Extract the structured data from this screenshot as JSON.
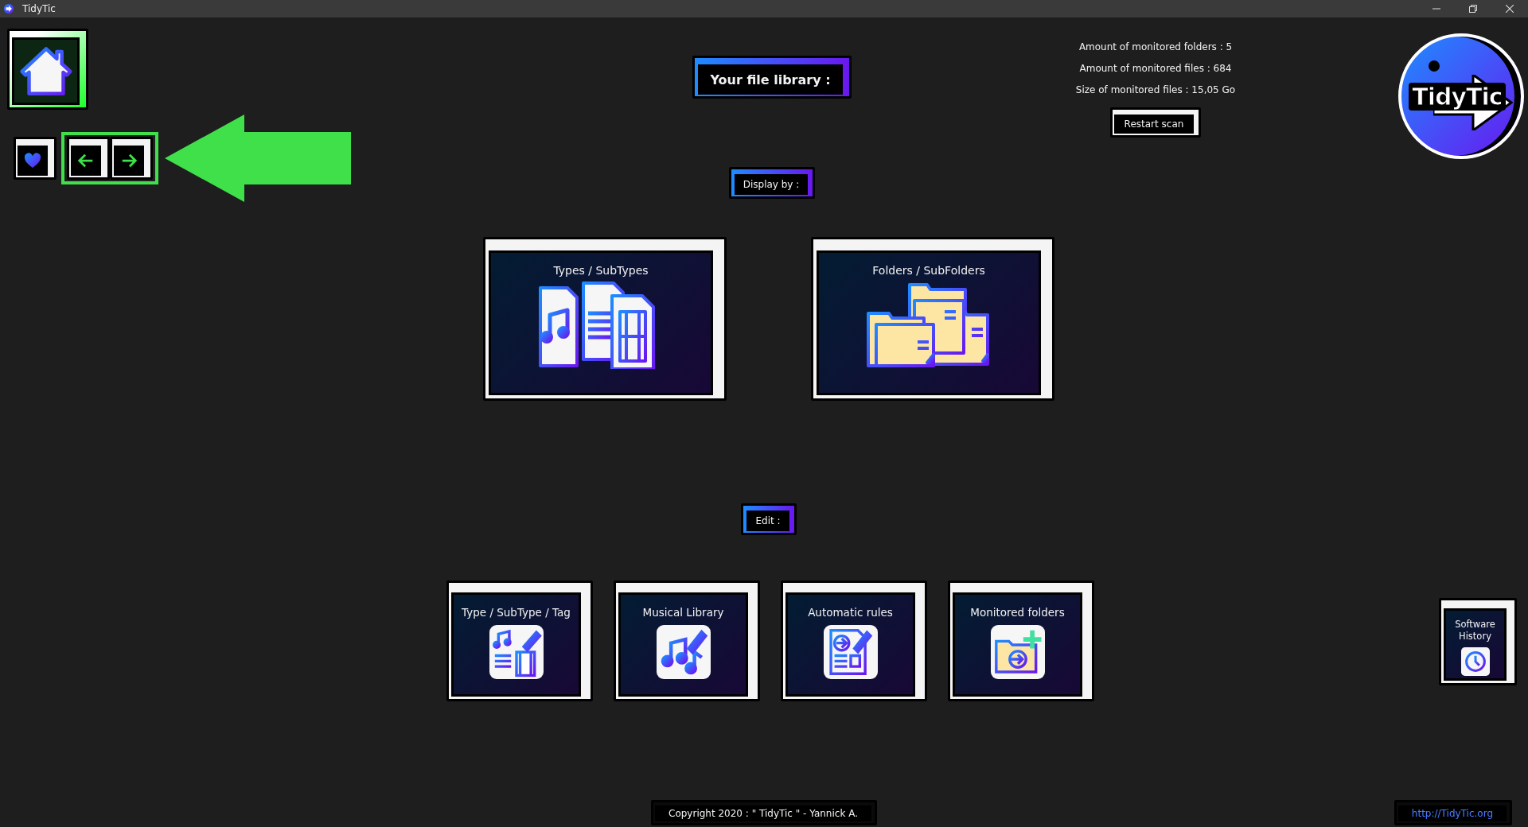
{
  "window": {
    "title": "TidyTic"
  },
  "home": {
    "selected": true
  },
  "library_label": "Your file library :",
  "stats": [
    "Amount of monitored folders : 5",
    "Amount of monitored files : 684",
    "Size of monitored files : 15,05 Go"
  ],
  "restart_button": "Restart scan",
  "logo_text": "TidyTic",
  "display_label": "Display by :",
  "display_options": [
    {
      "label": "Types / SubTypes",
      "kind": "types"
    },
    {
      "label": "Folders / SubFolders",
      "kind": "folders"
    }
  ],
  "edit_label": "Edit :",
  "edit_options": [
    {
      "label": "Type / SubType / Tag",
      "kind": "tags"
    },
    {
      "label": "Musical Library",
      "kind": "music"
    },
    {
      "label": "Automatic rules",
      "kind": "rules"
    },
    {
      "label": "Monitored folders",
      "kind": "folders"
    }
  ],
  "history_button": "Software History",
  "copyright": "Copyright 2020 : \" TidyTic \" - Yannick A.",
  "website_link": "http://TidyTic.org"
}
